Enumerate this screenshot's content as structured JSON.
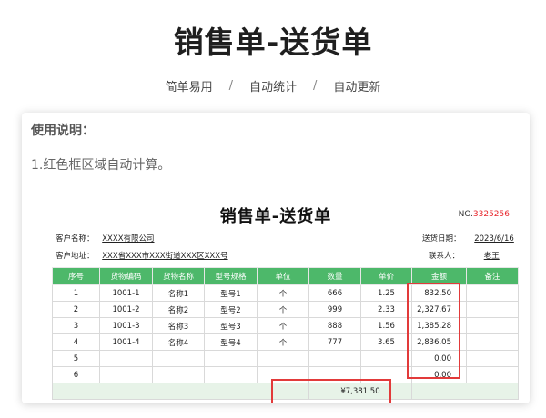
{
  "header": {
    "title": "销售单-送货单",
    "tags": [
      "简单易用",
      "自动统计",
      "自动更新"
    ],
    "separator": "/"
  },
  "instructions": {
    "title": "使用说明：",
    "line1": "1.红色框区域自动计算。"
  },
  "sheet": {
    "title": "销售单-送货单",
    "no_label": "NO.",
    "no_value": "3325256",
    "customer_name_label": "客户名称：",
    "customer_name": "XXXX有限公司",
    "customer_address_label": "客户地址：",
    "customer_address": "XXX省XXX市XXX街道XXX区XXX号",
    "delivery_date_label": "送货日期：",
    "delivery_date": "2023/6/16",
    "contact_label": "联系人：",
    "contact": "老王",
    "columns": [
      "序号",
      "货物编码",
      "货物名称",
      "型号规格",
      "单位",
      "数量",
      "单价",
      "金额",
      "备注"
    ],
    "rows": [
      {
        "no": "1",
        "code": "1001-1",
        "name": "名称1",
        "model": "型号1",
        "unit": "个",
        "qty": "666",
        "price": "1.25",
        "amount": "832.50",
        "note": ""
      },
      {
        "no": "2",
        "code": "1001-2",
        "name": "名称2",
        "model": "型号2",
        "unit": "个",
        "qty": "999",
        "price": "2.33",
        "amount": "2,327.67",
        "note": ""
      },
      {
        "no": "3",
        "code": "1001-3",
        "name": "名称3",
        "model": "型号3",
        "unit": "个",
        "qty": "888",
        "price": "1.56",
        "amount": "1,385.28",
        "note": ""
      },
      {
        "no": "4",
        "code": "1001-4",
        "name": "名称4",
        "model": "型号4",
        "unit": "个",
        "qty": "777",
        "price": "3.65",
        "amount": "2,836.05",
        "note": ""
      },
      {
        "no": "5",
        "code": "",
        "name": "",
        "model": "",
        "unit": "",
        "qty": "",
        "price": "",
        "amount": "0.00",
        "note": ""
      },
      {
        "no": "6",
        "code": "",
        "name": "",
        "model": "",
        "unit": "",
        "qty": "",
        "price": "",
        "amount": "0.00",
        "note": ""
      }
    ],
    "total": "¥7,381.50"
  },
  "colors": {
    "header_green": "#4db86a",
    "highlight_red": "#e23a3a",
    "number_red": "#e8262c"
  }
}
